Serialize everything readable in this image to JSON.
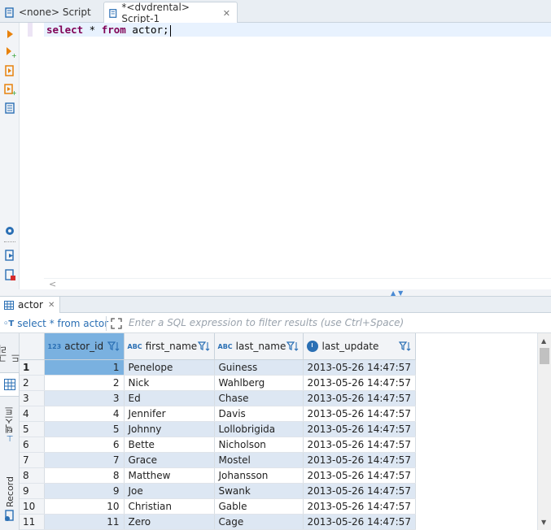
{
  "tabs": [
    {
      "label": "<none> Script",
      "active": false
    },
    {
      "label": "*<dvdrental> Script-1",
      "active": true
    }
  ],
  "editor": {
    "tokens": [
      {
        "text": "select",
        "kind": "keyword"
      },
      {
        "text": " * ",
        "kind": "plain"
      },
      {
        "text": "from",
        "kind": "keyword"
      },
      {
        "text": " actor;",
        "kind": "plain"
      }
    ]
  },
  "left_toolbar": [
    "execute-statement-icon",
    "execute-statement-new-tab-icon",
    "execute-script-icon",
    "execute-script-new-tab-icon",
    "explain-plan-icon",
    "settings-icon",
    "export-icon",
    "error-log-icon"
  ],
  "results": {
    "tab_label": "actor",
    "filter_query": "select * from actor",
    "filter_placeholder": "Enter a SQL expression to filter results (use Ctrl+Space)",
    "side_tabs": [
      "그리드",
      "텍스트",
      "Record"
    ],
    "columns": [
      {
        "name": "actor_id",
        "type_badge": "123"
      },
      {
        "name": "first_name",
        "type_badge": "ABC"
      },
      {
        "name": "last_name",
        "type_badge": "ABC"
      },
      {
        "name": "last_update",
        "type_badge": "clock"
      }
    ],
    "rows": [
      {
        "n": "1",
        "actor_id": "1",
        "first_name": "Penelope",
        "last_name": "Guiness",
        "last_update": "2013-05-26 14:47:57"
      },
      {
        "n": "2",
        "actor_id": "2",
        "first_name": "Nick",
        "last_name": "Wahlberg",
        "last_update": "2013-05-26 14:47:57"
      },
      {
        "n": "3",
        "actor_id": "3",
        "first_name": "Ed",
        "last_name": "Chase",
        "last_update": "2013-05-26 14:47:57"
      },
      {
        "n": "4",
        "actor_id": "4",
        "first_name": "Jennifer",
        "last_name": "Davis",
        "last_update": "2013-05-26 14:47:57"
      },
      {
        "n": "5",
        "actor_id": "5",
        "first_name": "Johnny",
        "last_name": "Lollobrigida",
        "last_update": "2013-05-26 14:47:57"
      },
      {
        "n": "6",
        "actor_id": "6",
        "first_name": "Bette",
        "last_name": "Nicholson",
        "last_update": "2013-05-26 14:47:57"
      },
      {
        "n": "7",
        "actor_id": "7",
        "first_name": "Grace",
        "last_name": "Mostel",
        "last_update": "2013-05-26 14:47:57"
      },
      {
        "n": "8",
        "actor_id": "8",
        "first_name": "Matthew",
        "last_name": "Johansson",
        "last_update": "2013-05-26 14:47:57"
      },
      {
        "n": "9",
        "actor_id": "9",
        "first_name": "Joe",
        "last_name": "Swank",
        "last_update": "2013-05-26 14:47:57"
      },
      {
        "n": "10",
        "actor_id": "10",
        "first_name": "Christian",
        "last_name": "Gable",
        "last_update": "2013-05-26 14:47:57"
      },
      {
        "n": "11",
        "actor_id": "11",
        "first_name": "Zero",
        "last_name": "Cage",
        "last_update": "2013-05-26 14:47:57"
      }
    ]
  },
  "colors": {
    "accent": "#2a6fb4",
    "selection": "#7ab1e0",
    "stripe": "#dde7f3",
    "keyword": "#7f0055"
  }
}
